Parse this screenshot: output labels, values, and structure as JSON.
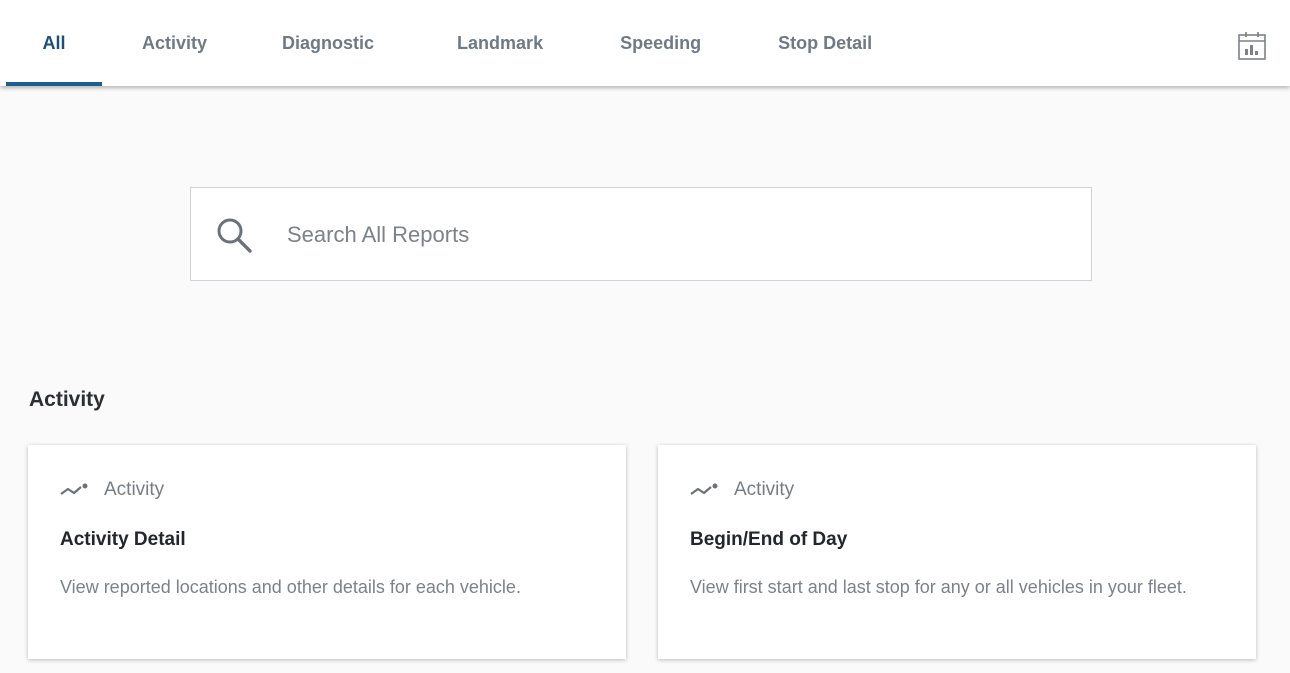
{
  "tabs": [
    {
      "label": "All",
      "active": true
    },
    {
      "label": "Activity",
      "active": false
    },
    {
      "label": "Diagnostic",
      "active": false
    },
    {
      "label": "Landmark",
      "active": false
    },
    {
      "label": "Speeding",
      "active": false
    },
    {
      "label": "Stop Detail",
      "active": false
    }
  ],
  "toolbar": {
    "report_icon": "calendar-chart-icon"
  },
  "search": {
    "placeholder": "Search All Reports",
    "value": "",
    "icon": "search-icon"
  },
  "section": {
    "title": "Activity",
    "cards": [
      {
        "category": "Activity",
        "category_icon": "activity-trend-icon",
        "title": "Activity Detail",
        "description": "View reported locations and other details for each vehicle."
      },
      {
        "category": "Activity",
        "category_icon": "activity-trend-icon",
        "title": "Begin/End of Day",
        "description": "View first start and last stop for any or all vehicles in your fleet."
      }
    ]
  },
  "colors": {
    "accent": "#1f5e8c",
    "active_tab_text": "#1f4f76",
    "inactive_tab_text": "#6f7a85",
    "muted_text": "#7c8288"
  }
}
